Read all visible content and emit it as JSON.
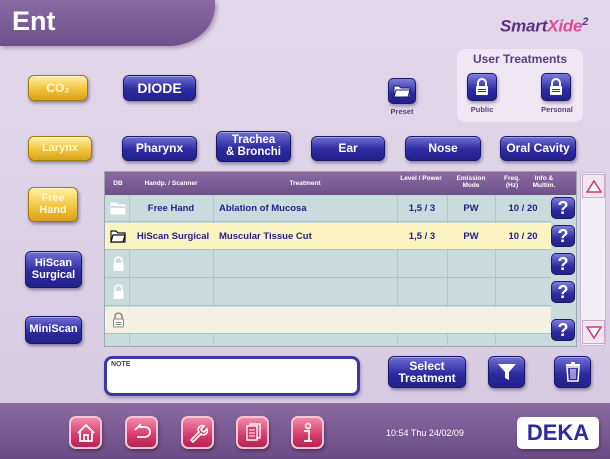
{
  "header": {
    "title": "Ent",
    "logo": {
      "part1": "Smart",
      "part2": "Xide",
      "sup": "2"
    }
  },
  "laser_buttons": [
    {
      "label": "CO₂",
      "state": "selected"
    },
    {
      "label": "DIODE",
      "state": "normal"
    }
  ],
  "preset": {
    "label": "Preset",
    "icon": "folder-icon"
  },
  "user_treatments": {
    "title": "User Treatments",
    "public_label": "Public",
    "personal_label": "Personal"
  },
  "anatomy_tabs": [
    {
      "label": "Larynx",
      "state": "selected"
    },
    {
      "label": "Pharynx",
      "state": "normal"
    },
    {
      "label": "Trachea & Bronchi",
      "line1": "Trachea",
      "line2": "& Bronchi",
      "state": "normal"
    },
    {
      "label": "Ear",
      "state": "normal"
    },
    {
      "label": "Nose",
      "state": "normal"
    },
    {
      "label": "Oral Cavity",
      "state": "normal"
    }
  ],
  "handpieces": [
    {
      "label": "Free Hand",
      "line1": "Free",
      "line2": "Hand",
      "state": "selected"
    },
    {
      "label": "HiScan Surgical",
      "line1": "HiScan",
      "line2": "Surgical",
      "state": "normal"
    },
    {
      "label": "MiniScan",
      "state": "normal"
    }
  ],
  "table": {
    "headers": {
      "db": "DB",
      "handpiece": "Handp. / Scanner",
      "treatment": "Treatment",
      "level": "Level / Power",
      "emission": "Emission Mode",
      "freq": "Freq. (Hz)",
      "info": "Info & Multim."
    },
    "rows": [
      {
        "db_icon": "folder-icon",
        "handpiece": "Free Hand",
        "treatment": "Ablation of Mucosa",
        "level": "1,5 / 3",
        "emission": "PW",
        "freq": "10 / 20",
        "help": "?",
        "selected": false
      },
      {
        "db_icon": "folder-icon",
        "handpiece": "HiScan Surgical",
        "treatment": "Muscular Tissue Cut",
        "level": "1,5 / 3",
        "emission": "PW",
        "freq": "10 / 20",
        "help": "?",
        "selected": true
      },
      {
        "db_icon": "lock-icon",
        "handpiece": "",
        "treatment": "",
        "level": "",
        "emission": "",
        "freq": "",
        "help": "?",
        "selected": false
      },
      {
        "db_icon": "lock-icon",
        "handpiece": "",
        "treatment": "",
        "level": "",
        "emission": "",
        "freq": "",
        "help": "?",
        "selected": false
      },
      {
        "db_icon": "lock-icon",
        "handpiece": "",
        "treatment": "",
        "level": "",
        "emission": "",
        "freq": "",
        "help": "?",
        "selected": false
      }
    ]
  },
  "note": {
    "label": "NOTE",
    "value": ""
  },
  "actions": {
    "select_line1": "Select",
    "select_line2": "Treatment"
  },
  "footer": {
    "clock": "10:54  Thu 24/02/09",
    "brand": "DEKA"
  },
  "colors": {
    "accent": "#2d2ba0",
    "selected": "#f2c23c",
    "header": "#7a5c96",
    "footer_buttons": "#d63a6a"
  }
}
